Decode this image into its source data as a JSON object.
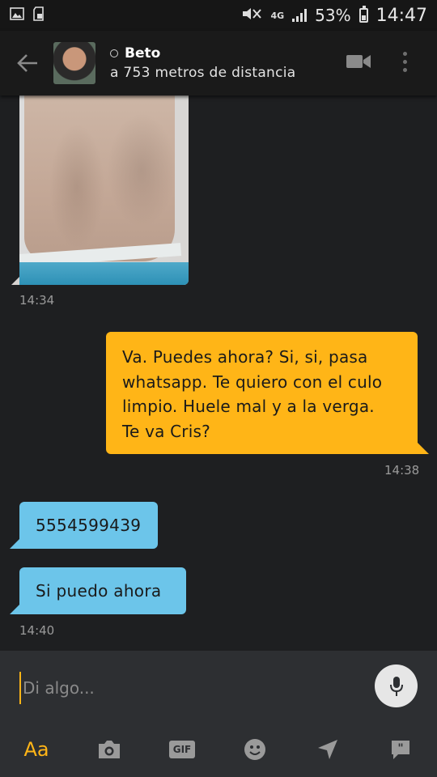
{
  "status_bar": {
    "network": "4G",
    "battery": "53%",
    "time": "14:47"
  },
  "header": {
    "contact_name": "Beto",
    "distance": "a 753 metros de distancia"
  },
  "messages": [
    {
      "type": "photo",
      "direction": "incoming",
      "timestamp": "14:34"
    },
    {
      "type": "text",
      "direction": "outgoing",
      "text": "Va. Puedes ahora? Si, si, pasa whatsapp.  Te quiero con el culo limpio. Huele mal y a la verga. Te va Cris?",
      "lines": [
        "Va. Puedes ahora? Si, si, pasa",
        "whatsapp.  Te quiero con el culo",
        "limpio. Huele mal y a la verga.",
        "Te va Cris?"
      ],
      "timestamp": "14:38"
    },
    {
      "type": "text",
      "direction": "incoming",
      "text": "5554599439"
    },
    {
      "type": "text",
      "direction": "incoming",
      "text": "Si puedo ahora",
      "timestamp": "14:40"
    }
  ],
  "composer": {
    "placeholder": "Di algo...",
    "toolbar": {
      "text_label": "Aa",
      "gif_label": "GIF"
    }
  },
  "colors": {
    "accent": "#ffb517",
    "incoming_bubble": "#6cc5ea",
    "background": "#1e1f21"
  }
}
